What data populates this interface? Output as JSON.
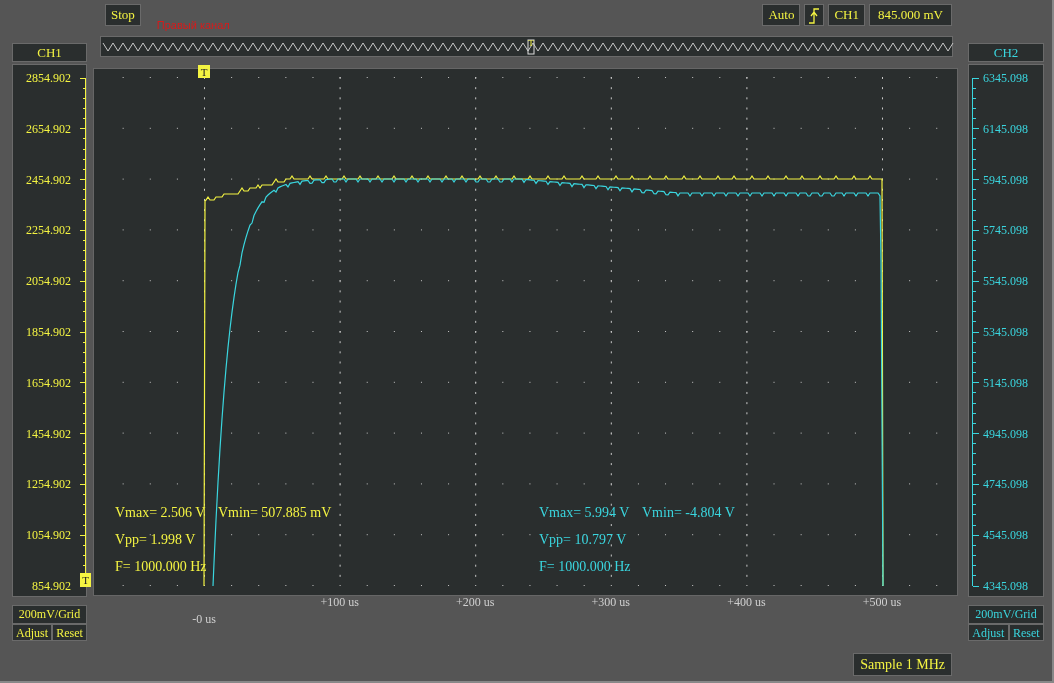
{
  "toolbar": {
    "run_button": "Stop",
    "channel_note": "Правый канал",
    "trigger_mode": "Auto",
    "trigger_source": "CH1",
    "trigger_level": "845.000 mV"
  },
  "overview": {
    "marker": "T"
  },
  "plot": {
    "trigger_marker": "T",
    "time_labels": [
      "-0 us",
      "+100 us",
      "+200 us",
      "+300 us",
      "+400 us",
      "+500 us"
    ]
  },
  "channels": [
    {
      "name": "CH1",
      "color": "#f4f442",
      "scale_labels": [
        "2854.902",
        "2654.902",
        "2454.902",
        "2254.902",
        "2054.902",
        "1854.902",
        "1654.902",
        "1454.902",
        "1254.902",
        "1054.902",
        "854.902"
      ],
      "trigger_marker": "T",
      "readouts": [
        "Vmax= 2.506 V",
        "Vmin= 507.885 mV",
        "Vpp= 1.998 V",
        "F= 1000.000 Hz"
      ],
      "grid": "200mV/Grid",
      "buttons": [
        "Adjust",
        "Reset"
      ]
    },
    {
      "name": "CH2",
      "color": "#3ad6df",
      "scale_labels": [
        "6345.098",
        "6145.098",
        "5945.098",
        "5745.098",
        "5545.098",
        "5345.098",
        "5145.098",
        "4945.098",
        "4745.098",
        "4545.098",
        "4345.098"
      ],
      "readouts": [
        "Vmax= 5.994 V",
        "Vmin= -4.804 V",
        "Vpp= 10.797 V",
        "F= 1000.000 Hz"
      ],
      "grid": "200mV/Grid",
      "buttons": [
        "Adjust",
        "Reset"
      ]
    }
  ],
  "status": "Sample 1 MHz"
}
